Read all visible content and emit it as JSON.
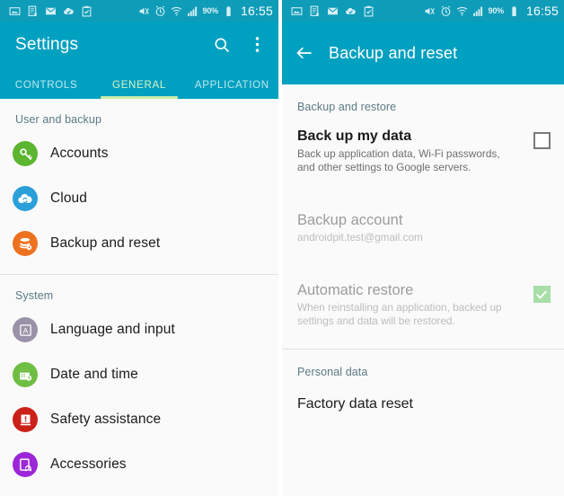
{
  "theme": {
    "statusbar_bg": "#0e9cb8",
    "appbar_bg": "#00a0c0",
    "accent_tab": "#c8ecaa",
    "page_bg": "#fafafa",
    "checkbox_on": "#a8dfa8"
  },
  "statusbar": {
    "icons_left": [
      "image-icon",
      "document-x-icon",
      "mail-icon",
      "cloud-check-icon",
      "clipboard-check-icon"
    ],
    "icons_right": [
      "mute-icon",
      "alarm-icon",
      "wifi-icon",
      "signal-icon"
    ],
    "battery_percent": "90%",
    "battery_icon": "battery-icon",
    "clock": "16:55"
  },
  "left_screen": {
    "appbar": {
      "title": "Settings",
      "search_icon": "search-icon",
      "overflow_icon": "overflow-menu-icon"
    },
    "tabs": [
      {
        "label": "CONTROLS",
        "active": false
      },
      {
        "label": "GENERAL",
        "active": true
      },
      {
        "label": "APPLICATION",
        "active": false
      }
    ],
    "sections": [
      {
        "header": "User and backup",
        "items": [
          {
            "label": "Accounts",
            "icon": "key-icon",
            "color": "#5cb531"
          },
          {
            "label": "Cloud",
            "icon": "cloud-sync-icon",
            "color": "#2a9fd8"
          },
          {
            "label": "Backup and reset",
            "icon": "database-clock-icon",
            "color": "#ed7220"
          }
        ]
      },
      {
        "header": "System",
        "items": [
          {
            "label": "Language and input",
            "icon": "letter-a-icon",
            "color": "#9a92a8"
          },
          {
            "label": "Date and time",
            "icon": "calendar-clock-icon",
            "color": "#6fbe44"
          },
          {
            "label": "Safety assistance",
            "icon": "alert-icon",
            "color": "#cc2118"
          },
          {
            "label": "Accessories",
            "icon": "headphone-device-icon",
            "color": "#9c27d8"
          }
        ]
      }
    ]
  },
  "right_screen": {
    "appbar": {
      "back_icon": "back-arrow-icon",
      "title": "Backup and reset"
    },
    "sections": [
      {
        "header": "Backup and restore",
        "rows": [
          {
            "title": "Back up my data",
            "subtitle": "Back up application data, Wi-Fi passwords, and other settings to Google servers.",
            "control": "checkbox",
            "checked": false,
            "dim": false
          },
          {
            "title": "Backup account",
            "subtitle": "androidpit.test@gmail.com",
            "control": "none",
            "checked": false,
            "dim": true
          },
          {
            "title": "Automatic restore",
            "subtitle": "When reinstalling an application, backed up settings and data will be restored.",
            "control": "checkbox",
            "checked": true,
            "dim": true
          }
        ]
      },
      {
        "header": "Personal data",
        "plain_rows": [
          {
            "label": "Factory data reset"
          }
        ]
      }
    ]
  }
}
